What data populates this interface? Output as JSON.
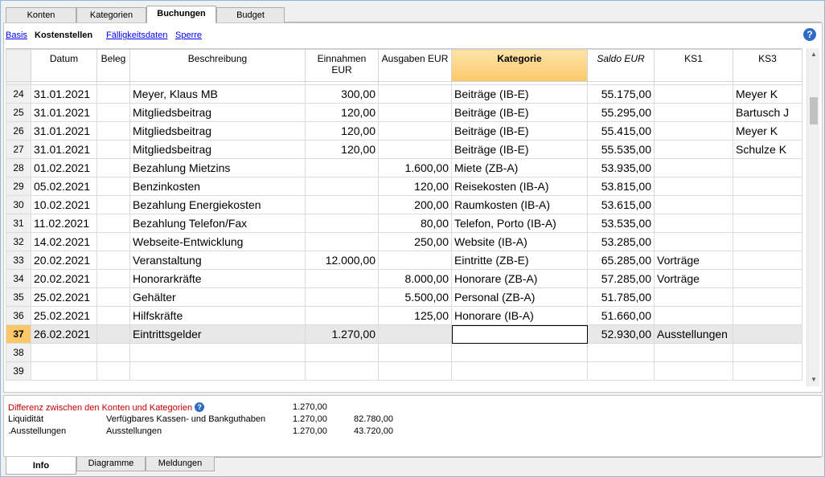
{
  "top_tabs": [
    "Konten",
    "Kategorien",
    "Buchungen",
    "Budget"
  ],
  "views": {
    "basis": "Basis",
    "kostenstellen": "Kostenstellen",
    "faelligkeit": "Fälligkeitsdaten",
    "sperre": "Sperre"
  },
  "help_icon": "question-mark",
  "columns": {
    "datum": "Datum",
    "beleg": "Beleg",
    "beschreibung": "Beschreibung",
    "einnahmen": "Einnahmen EUR",
    "ausgaben": "Ausgaben EUR",
    "kategorie": "Kategorie",
    "saldo": "Saldo EUR",
    "ks1": "KS1",
    "ks3": "KS3"
  },
  "rows": [
    {
      "n": "24",
      "datum": "31.01.2021",
      "beleg": "",
      "beschreibung": "Meyer, Klaus MB",
      "einnahmen": "300,00",
      "ausgaben": "",
      "kategorie": "Beiträge (IB-E)",
      "saldo": "55.175,00",
      "ks1": "",
      "ks3": "Meyer K"
    },
    {
      "n": "25",
      "datum": "31.01.2021",
      "beleg": "",
      "beschreibung": "Mitgliedsbeitrag",
      "einnahmen": "120,00",
      "ausgaben": "",
      "kategorie": "Beiträge (IB-E)",
      "saldo": "55.295,00",
      "ks1": "",
      "ks3": "Bartusch J"
    },
    {
      "n": "26",
      "datum": "31.01.2021",
      "beleg": "",
      "beschreibung": "Mitgliedsbeitrag",
      "einnahmen": "120,00",
      "ausgaben": "",
      "kategorie": "Beiträge (IB-E)",
      "saldo": "55.415,00",
      "ks1": "",
      "ks3": "Meyer K"
    },
    {
      "n": "27",
      "datum": "31.01.2021",
      "beleg": "",
      "beschreibung": "Mitgliedsbeitrag",
      "einnahmen": "120,00",
      "ausgaben": "",
      "kategorie": "Beiträge (IB-E)",
      "saldo": "55.535,00",
      "ks1": "",
      "ks3": "Schulze K"
    },
    {
      "n": "28",
      "datum": "01.02.2021",
      "beleg": "",
      "beschreibung": "Bezahlung Mietzins",
      "einnahmen": "",
      "ausgaben": "1.600,00",
      "kategorie": "Miete (ZB-A)",
      "saldo": "53.935,00",
      "ks1": "",
      "ks3": ""
    },
    {
      "n": "29",
      "datum": "05.02.2021",
      "beleg": "",
      "beschreibung": "Benzinkosten",
      "einnahmen": "",
      "ausgaben": "120,00",
      "kategorie": "Reisekosten (IB-A)",
      "saldo": "53.815,00",
      "ks1": "",
      "ks3": ""
    },
    {
      "n": "30",
      "datum": "10.02.2021",
      "beleg": "",
      "beschreibung": "Bezahlung Energiekosten",
      "einnahmen": "",
      "ausgaben": "200,00",
      "kategorie": "Raumkosten (IB-A)",
      "saldo": "53.615,00",
      "ks1": "",
      "ks3": ""
    },
    {
      "n": "31",
      "datum": "11.02.2021",
      "beleg": "",
      "beschreibung": "Bezahlung Telefon/Fax",
      "einnahmen": "",
      "ausgaben": "80,00",
      "kategorie": "Telefon, Porto (IB-A)",
      "saldo": "53.535,00",
      "ks1": "",
      "ks3": ""
    },
    {
      "n": "32",
      "datum": "14.02.2021",
      "beleg": "",
      "beschreibung": "Webseite-Entwicklung",
      "einnahmen": "",
      "ausgaben": "250,00",
      "kategorie": "Website (IB-A)",
      "saldo": "53.285,00",
      "ks1": "",
      "ks3": ""
    },
    {
      "n": "33",
      "datum": "20.02.2021",
      "beleg": "",
      "beschreibung": "Veranstaltung",
      "einnahmen": "12.000,00",
      "ausgaben": "",
      "kategorie": "Eintritte (ZB-E)",
      "saldo": "65.285,00",
      "ks1": "Vorträge",
      "ks3": ""
    },
    {
      "n": "34",
      "datum": "20.02.2021",
      "beleg": "",
      "beschreibung": "Honorarkräfte",
      "einnahmen": "",
      "ausgaben": "8.000,00",
      "kategorie": "Honorare (ZB-A)",
      "saldo": "57.285,00",
      "ks1": "Vorträge",
      "ks3": ""
    },
    {
      "n": "35",
      "datum": "25.02.2021",
      "beleg": "",
      "beschreibung": "Gehälter",
      "einnahmen": "",
      "ausgaben": "5.500,00",
      "kategorie": "Personal (ZB-A)",
      "saldo": "51.785,00",
      "ks1": "",
      "ks3": ""
    },
    {
      "n": "36",
      "datum": "25.02.2021",
      "beleg": "",
      "beschreibung": "Hilfskräfte",
      "einnahmen": "",
      "ausgaben": "125,00",
      "kategorie": "Honorare (IB-A)",
      "saldo": "51.660,00",
      "ks1": "",
      "ks3": ""
    },
    {
      "n": "37",
      "datum": "26.02.2021",
      "beleg": "",
      "beschreibung": "Eintrittsgelder",
      "einnahmen": "1.270,00",
      "ausgaben": "",
      "kategorie": "",
      "saldo": "52.930,00",
      "ks1": "Ausstellungen",
      "ks3": ""
    },
    {
      "n": "38",
      "datum": "",
      "beleg": "",
      "beschreibung": "",
      "einnahmen": "",
      "ausgaben": "",
      "kategorie": "",
      "saldo": "",
      "ks1": "",
      "ks3": ""
    },
    {
      "n": "39",
      "datum": "",
      "beleg": "",
      "beschreibung": "",
      "einnahmen": "",
      "ausgaben": "",
      "kategorie": "",
      "saldo": "",
      "ks1": "",
      "ks3": ""
    }
  ],
  "current_row": "37",
  "info": {
    "diff_label": "Differenz zwischen den Konten und Kategorien",
    "diff_value": "1.270,00",
    "rows": [
      {
        "account": "Liquidität",
        "desc": "Verfügbares Kassen- und Bankguthaben",
        "v1": "1.270,00",
        "v2": "82.780,00"
      },
      {
        "account": ".Ausstellungen",
        "desc": "Ausstellungen",
        "v1": "1.270,00",
        "v2": "43.720,00"
      }
    ]
  },
  "bottom_tabs": [
    "Info",
    "Diagramme",
    "Meldungen"
  ],
  "colors": {
    "header_accent": "#fbc869",
    "link": "#0000ee",
    "diff_text": "#c00000",
    "help": "#2e6bc6"
  }
}
